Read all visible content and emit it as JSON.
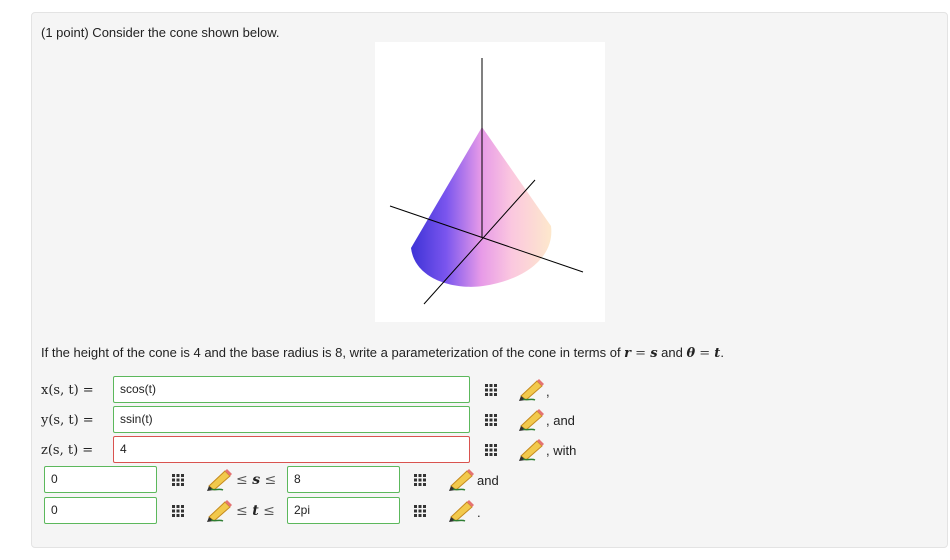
{
  "problem": {
    "intro": "(1 point) Consider the cone shown below.",
    "question_text": "If the height of the cone is 4 and the base radius is 8, write a parameterization of the cone in terms of ",
    "r_var": "r",
    "eq1": " = ",
    "s_var": "s",
    "and_text": " and ",
    "theta_var": "θ",
    "eq2": " = ",
    "t_var": "t",
    "period": "."
  },
  "equations": [
    {
      "lhs": "x(s, t) =",
      "value": "scos(t)",
      "status": "correct",
      "trailing": ","
    },
    {
      "lhs": "y(s, t) =",
      "value": "ssin(t)",
      "status": "correct",
      "trailing": ", and"
    },
    {
      "lhs": "z(s, t) =",
      "value": "4",
      "status": "incorrect",
      "trailing": ", with"
    }
  ],
  "bounds": [
    {
      "lower": "0",
      "var": "s",
      "upper": "8",
      "trailing": "and"
    },
    {
      "lower": "0",
      "var": "t",
      "upper": "2pi",
      "trailing": "."
    }
  ],
  "symbols": {
    "le": "≤"
  },
  "icons": {
    "palette": "equation-editor-icon",
    "pencil": "pencil-icon"
  },
  "colors": {
    "correct_border": "#5cb85c",
    "incorrect_border": "#d9534f",
    "cone_dark": "#4a3fd8",
    "cone_light": "#fde6cc"
  }
}
